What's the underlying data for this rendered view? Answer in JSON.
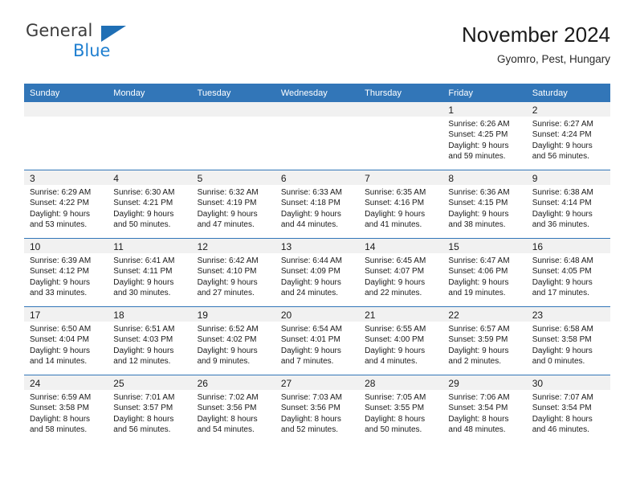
{
  "brand": {
    "name_top": "General",
    "name_bottom": "Blue",
    "triangle_color": "#1f6fb5",
    "blue_text_color": "#1f7fd0"
  },
  "header": {
    "title": "November 2024",
    "subtitle": "Gyomro, Pest, Hungary"
  },
  "theme": {
    "header_bar_color": "#3276b8",
    "daynum_band_color": "#f1f1f1",
    "cell_divider_color": "#3276b8"
  },
  "weekdays": [
    "Sunday",
    "Monday",
    "Tuesday",
    "Wednesday",
    "Thursday",
    "Friday",
    "Saturday"
  ],
  "weeks": [
    [
      {
        "day": "",
        "empty": true
      },
      {
        "day": "",
        "empty": true
      },
      {
        "day": "",
        "empty": true
      },
      {
        "day": "",
        "empty": true
      },
      {
        "day": "",
        "empty": true
      },
      {
        "day": "1",
        "sunrise": "Sunrise: 6:26 AM",
        "sunset": "Sunset: 4:25 PM",
        "daylight1": "Daylight: 9 hours",
        "daylight2": "and 59 minutes."
      },
      {
        "day": "2",
        "sunrise": "Sunrise: 6:27 AM",
        "sunset": "Sunset: 4:24 PM",
        "daylight1": "Daylight: 9 hours",
        "daylight2": "and 56 minutes."
      }
    ],
    [
      {
        "day": "3",
        "sunrise": "Sunrise: 6:29 AM",
        "sunset": "Sunset: 4:22 PM",
        "daylight1": "Daylight: 9 hours",
        "daylight2": "and 53 minutes."
      },
      {
        "day": "4",
        "sunrise": "Sunrise: 6:30 AM",
        "sunset": "Sunset: 4:21 PM",
        "daylight1": "Daylight: 9 hours",
        "daylight2": "and 50 minutes."
      },
      {
        "day": "5",
        "sunrise": "Sunrise: 6:32 AM",
        "sunset": "Sunset: 4:19 PM",
        "daylight1": "Daylight: 9 hours",
        "daylight2": "and 47 minutes."
      },
      {
        "day": "6",
        "sunrise": "Sunrise: 6:33 AM",
        "sunset": "Sunset: 4:18 PM",
        "daylight1": "Daylight: 9 hours",
        "daylight2": "and 44 minutes."
      },
      {
        "day": "7",
        "sunrise": "Sunrise: 6:35 AM",
        "sunset": "Sunset: 4:16 PM",
        "daylight1": "Daylight: 9 hours",
        "daylight2": "and 41 minutes."
      },
      {
        "day": "8",
        "sunrise": "Sunrise: 6:36 AM",
        "sunset": "Sunset: 4:15 PM",
        "daylight1": "Daylight: 9 hours",
        "daylight2": "and 38 minutes."
      },
      {
        "day": "9",
        "sunrise": "Sunrise: 6:38 AM",
        "sunset": "Sunset: 4:14 PM",
        "daylight1": "Daylight: 9 hours",
        "daylight2": "and 36 minutes."
      }
    ],
    [
      {
        "day": "10",
        "sunrise": "Sunrise: 6:39 AM",
        "sunset": "Sunset: 4:12 PM",
        "daylight1": "Daylight: 9 hours",
        "daylight2": "and 33 minutes."
      },
      {
        "day": "11",
        "sunrise": "Sunrise: 6:41 AM",
        "sunset": "Sunset: 4:11 PM",
        "daylight1": "Daylight: 9 hours",
        "daylight2": "and 30 minutes."
      },
      {
        "day": "12",
        "sunrise": "Sunrise: 6:42 AM",
        "sunset": "Sunset: 4:10 PM",
        "daylight1": "Daylight: 9 hours",
        "daylight2": "and 27 minutes."
      },
      {
        "day": "13",
        "sunrise": "Sunrise: 6:44 AM",
        "sunset": "Sunset: 4:09 PM",
        "daylight1": "Daylight: 9 hours",
        "daylight2": "and 24 minutes."
      },
      {
        "day": "14",
        "sunrise": "Sunrise: 6:45 AM",
        "sunset": "Sunset: 4:07 PM",
        "daylight1": "Daylight: 9 hours",
        "daylight2": "and 22 minutes."
      },
      {
        "day": "15",
        "sunrise": "Sunrise: 6:47 AM",
        "sunset": "Sunset: 4:06 PM",
        "daylight1": "Daylight: 9 hours",
        "daylight2": "and 19 minutes."
      },
      {
        "day": "16",
        "sunrise": "Sunrise: 6:48 AM",
        "sunset": "Sunset: 4:05 PM",
        "daylight1": "Daylight: 9 hours",
        "daylight2": "and 17 minutes."
      }
    ],
    [
      {
        "day": "17",
        "sunrise": "Sunrise: 6:50 AM",
        "sunset": "Sunset: 4:04 PM",
        "daylight1": "Daylight: 9 hours",
        "daylight2": "and 14 minutes."
      },
      {
        "day": "18",
        "sunrise": "Sunrise: 6:51 AM",
        "sunset": "Sunset: 4:03 PM",
        "daylight1": "Daylight: 9 hours",
        "daylight2": "and 12 minutes."
      },
      {
        "day": "19",
        "sunrise": "Sunrise: 6:52 AM",
        "sunset": "Sunset: 4:02 PM",
        "daylight1": "Daylight: 9 hours",
        "daylight2": "and 9 minutes."
      },
      {
        "day": "20",
        "sunrise": "Sunrise: 6:54 AM",
        "sunset": "Sunset: 4:01 PM",
        "daylight1": "Daylight: 9 hours",
        "daylight2": "and 7 minutes."
      },
      {
        "day": "21",
        "sunrise": "Sunrise: 6:55 AM",
        "sunset": "Sunset: 4:00 PM",
        "daylight1": "Daylight: 9 hours",
        "daylight2": "and 4 minutes."
      },
      {
        "day": "22",
        "sunrise": "Sunrise: 6:57 AM",
        "sunset": "Sunset: 3:59 PM",
        "daylight1": "Daylight: 9 hours",
        "daylight2": "and 2 minutes."
      },
      {
        "day": "23",
        "sunrise": "Sunrise: 6:58 AM",
        "sunset": "Sunset: 3:58 PM",
        "daylight1": "Daylight: 9 hours",
        "daylight2": "and 0 minutes."
      }
    ],
    [
      {
        "day": "24",
        "sunrise": "Sunrise: 6:59 AM",
        "sunset": "Sunset: 3:58 PM",
        "daylight1": "Daylight: 8 hours",
        "daylight2": "and 58 minutes."
      },
      {
        "day": "25",
        "sunrise": "Sunrise: 7:01 AM",
        "sunset": "Sunset: 3:57 PM",
        "daylight1": "Daylight: 8 hours",
        "daylight2": "and 56 minutes."
      },
      {
        "day": "26",
        "sunrise": "Sunrise: 7:02 AM",
        "sunset": "Sunset: 3:56 PM",
        "daylight1": "Daylight: 8 hours",
        "daylight2": "and 54 minutes."
      },
      {
        "day": "27",
        "sunrise": "Sunrise: 7:03 AM",
        "sunset": "Sunset: 3:56 PM",
        "daylight1": "Daylight: 8 hours",
        "daylight2": "and 52 minutes."
      },
      {
        "day": "28",
        "sunrise": "Sunrise: 7:05 AM",
        "sunset": "Sunset: 3:55 PM",
        "daylight1": "Daylight: 8 hours",
        "daylight2": "and 50 minutes."
      },
      {
        "day": "29",
        "sunrise": "Sunrise: 7:06 AM",
        "sunset": "Sunset: 3:54 PM",
        "daylight1": "Daylight: 8 hours",
        "daylight2": "and 48 minutes."
      },
      {
        "day": "30",
        "sunrise": "Sunrise: 7:07 AM",
        "sunset": "Sunset: 3:54 PM",
        "daylight1": "Daylight: 8 hours",
        "daylight2": "and 46 minutes."
      }
    ]
  ]
}
